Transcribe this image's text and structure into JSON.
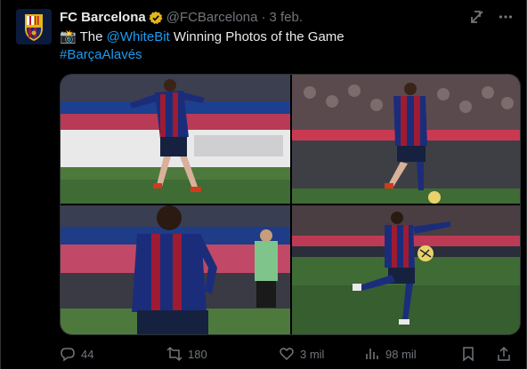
{
  "tweet": {
    "author_name": "FC Barcelona",
    "handle": "@FCBarcelona",
    "separator": "·",
    "date": "3 feb.",
    "emoji": "📸",
    "text_prefix": "The",
    "mention": "@WhiteBit",
    "text_suffix": "Winning Photos of the Game",
    "hashtag": "#BarçaAlavés"
  },
  "stats": {
    "replies": "44",
    "reposts": "180",
    "likes": "3 mil",
    "views": "98 mil"
  },
  "colors": {
    "background": "#000000",
    "text": "#e7e9ea",
    "muted": "#71767b",
    "link": "#1d9bf0",
    "verified_gold": "#e2b719",
    "kit_blue": "#1b2d7a",
    "kit_red": "#9e1b32",
    "pitch_green": "#3f6b35"
  },
  "icons": {
    "verified": "verified-badge-icon",
    "grok": "grok-icon",
    "more": "more-icon",
    "reply": "reply-icon",
    "repost": "repost-icon",
    "like": "like-icon",
    "views": "views-icon",
    "bookmark": "bookmark-icon",
    "share": "share-icon"
  }
}
